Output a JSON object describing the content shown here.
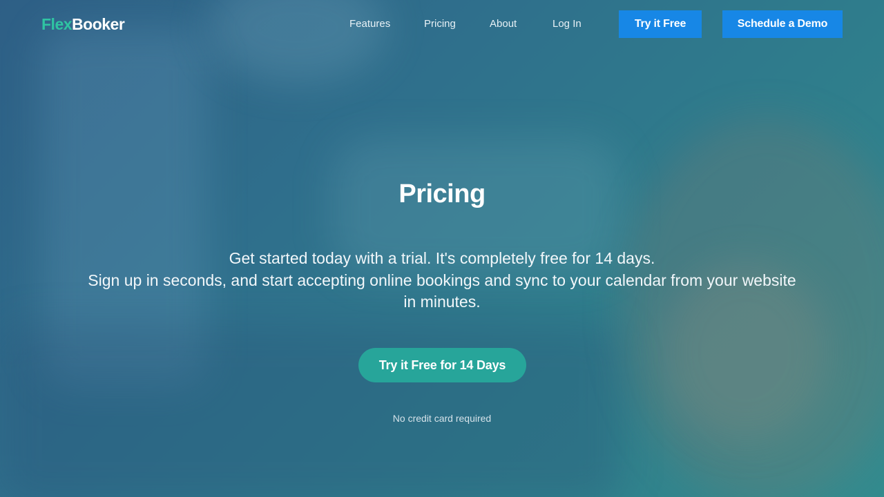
{
  "brand": {
    "logo_part1": "Flex",
    "logo_part2": "Booker",
    "logo_part1_color": "#2fc4a2"
  },
  "nav": {
    "items": [
      {
        "label": "Features"
      },
      {
        "label": "Pricing"
      },
      {
        "label": "About"
      },
      {
        "label": "Log In"
      }
    ],
    "try_button": "Try it Free",
    "demo_button": "Schedule a Demo",
    "button_color": "#1787e6"
  },
  "hero": {
    "title": "Pricing",
    "subtitle_line1": "Get started today with a trial. It's completely free for 14 days.",
    "subtitle_line2": "Sign up in seconds, and start accepting online bookings and sync to your calendar from your website in minutes.",
    "cta_button": "Try it Free for 14 Days",
    "cta_color": "#27a59a",
    "note": "No credit card required"
  }
}
